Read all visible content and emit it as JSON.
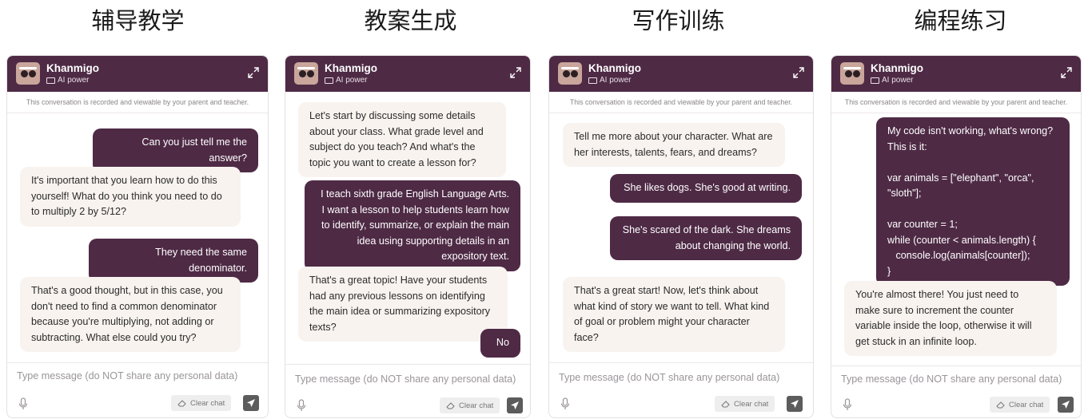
{
  "column_titles": [
    "辅导教学",
    "教案生成",
    "写作训练",
    "编程练习"
  ],
  "app": {
    "name": "Khanmigo",
    "power_label": "AI power",
    "notice": "This conversation is recorded and viewable by your parent and teacher.",
    "input_placeholder": "Type message (do NOT share any personal data)",
    "clear_label": "Clear chat",
    "icons": [
      "avatar-icon",
      "ai-power-icon",
      "expand-icon",
      "mic-icon",
      "eraser-icon",
      "send-icon"
    ],
    "colors": {
      "header": "#4e2a45",
      "user_bubble": "#4e2a45",
      "ai_bubble": "#f8f3ef"
    }
  },
  "panels": [
    {
      "messages": [
        {
          "role": "user",
          "text": "Can you just tell me the answer?"
        },
        {
          "role": "ai",
          "text": "It's important that you learn how to do this yourself! What do you think you need to do to multiply 2 by 5/12?"
        },
        {
          "role": "user",
          "text": "They need the same denominator."
        },
        {
          "role": "ai",
          "text": "That's a good thought, but in this case, you don't need to find a common denominator because you're multiplying, not adding or subtracting. What else could you try?"
        }
      ]
    },
    {
      "messages": [
        {
          "role": "ai",
          "text": "Let's start by discussing some details about your class. What grade level and subject do you teach? And what's the topic you want to create a lesson for?"
        },
        {
          "role": "user",
          "text": "I teach sixth grade English Language Arts. I want a lesson to help students learn how to identify, summarize, or explain the main idea using supporting details in an expository text."
        },
        {
          "role": "ai",
          "text": "That's a great topic! Have your students had any previous lessons on identifying the main idea or summarizing expository texts?"
        },
        {
          "role": "user",
          "text": "No"
        }
      ]
    },
    {
      "messages": [
        {
          "role": "ai",
          "text": "Tell me more about your character. What are her interests, talents, fears, and dreams?"
        },
        {
          "role": "user",
          "text": "She likes dogs. She's good at writing."
        },
        {
          "role": "user",
          "text": "She's scared of the dark. She dreams about changing the world."
        },
        {
          "role": "ai",
          "text": "That's a great start! Now, let's think about what kind of story we want to tell. What kind of goal or problem might your character face?"
        }
      ]
    },
    {
      "messages": [
        {
          "role": "user",
          "text": "My code isn't working, what's wrong?\nThis is it:\n\nvar animals = [\"elephant\", \"orca\", \"sloth\"];\n\nvar counter = 1;\nwhile (counter < animals.length) {\n   console.log(animals[counter]);\n}"
        },
        {
          "role": "ai",
          "text": "You're almost there! You just need to make sure to increment the counter variable inside the loop, otherwise it will get stuck in an infinite loop."
        }
      ]
    }
  ]
}
